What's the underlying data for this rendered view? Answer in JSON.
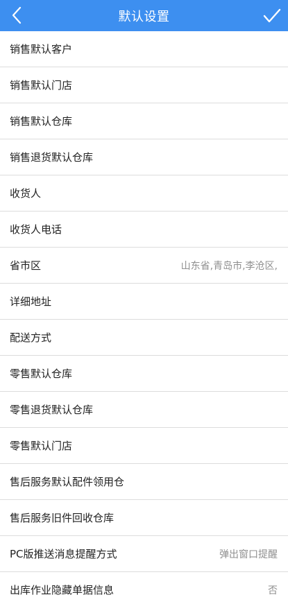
{
  "header": {
    "title": "默认设置",
    "back_icon": "chevron-left-icon",
    "confirm_icon": "checkmark-icon",
    "background_color": "#3d8ff0"
  },
  "settings": [
    {
      "label": "销售默认客户",
      "value": ""
    },
    {
      "label": "销售默认门店",
      "value": ""
    },
    {
      "label": "销售默认仓库",
      "value": ""
    },
    {
      "label": "销售退货默认仓库",
      "value": ""
    },
    {
      "label": "收货人",
      "value": ""
    },
    {
      "label": "收货人电话",
      "value": ""
    },
    {
      "label": "省市区",
      "value": "山东省,青岛市,李沧区,"
    },
    {
      "label": "详细地址",
      "value": ""
    },
    {
      "label": "配送方式",
      "value": ""
    },
    {
      "label": "零售默认仓库",
      "value": ""
    },
    {
      "label": "零售退货默认仓库",
      "value": ""
    },
    {
      "label": "零售默认门店",
      "value": ""
    },
    {
      "label": "售后服务默认配件领用仓",
      "value": ""
    },
    {
      "label": "售后服务旧件回收仓库",
      "value": ""
    },
    {
      "label": "PC版推送消息提醒方式",
      "value": "弹出窗口提醒"
    },
    {
      "label": "出库作业隐藏单据信息",
      "value": "否"
    }
  ]
}
